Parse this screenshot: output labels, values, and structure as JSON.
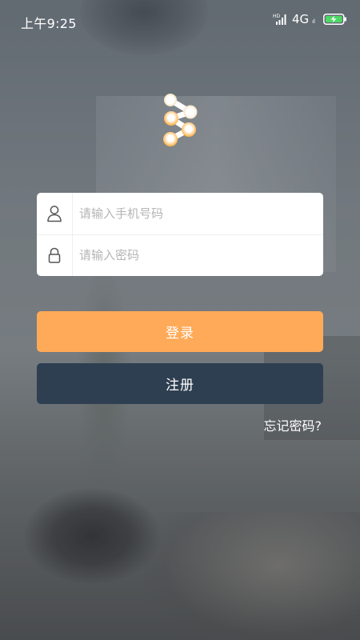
{
  "status_bar": {
    "time": "上午9:25",
    "hd_label": "HD",
    "network": "4G",
    "network_sub": "ıl"
  },
  "icons": {
    "logo": "share-nodes-logo-icon",
    "user": "user-icon",
    "lock": "lock-icon",
    "signal": "signal-icon",
    "battery": "battery-charging-icon"
  },
  "form": {
    "phone_placeholder": "请输入手机号码",
    "password_placeholder": "请输入密码"
  },
  "buttons": {
    "login_label": "登录",
    "register_label": "注册"
  },
  "links": {
    "forgot_password": "忘记密码?"
  },
  "colors": {
    "login_button": "#ffaa58",
    "register_button": "#2f3f52",
    "logo_white": "#ffffff",
    "logo_amber": "#ffb23c",
    "battery_green": "#4cd964"
  }
}
